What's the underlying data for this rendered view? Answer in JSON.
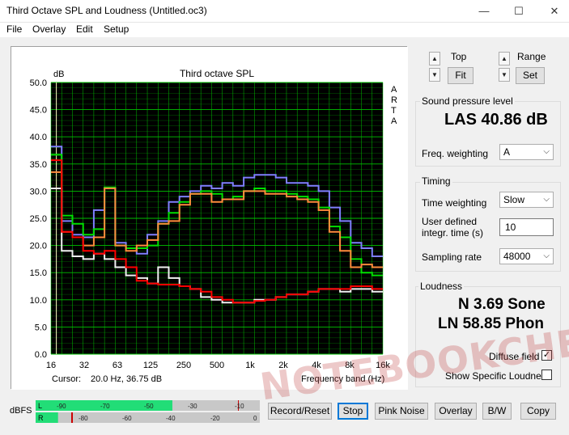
{
  "window": {
    "title": "Third Octave SPL and Loudness (Untitled.oc3)",
    "minimize": "—",
    "maximize": "☐",
    "close": "✕"
  },
  "menu": [
    "File",
    "Overlay",
    "Edit",
    "Setup"
  ],
  "plot": {
    "cursor_label": "Cursor:",
    "cursor_value": "20.0 Hz, 36.75 dB",
    "arta_letters": [
      "A",
      "R",
      "T",
      "A"
    ]
  },
  "chart_data": {
    "type": "line",
    "title": "Third octave SPL",
    "ylabel": "dB",
    "xlabel": "Frequency band (Hz)",
    "ylim": [
      0,
      50
    ],
    "yticks": [
      "50.0",
      "45.0",
      "40.0",
      "35.0",
      "30.0",
      "25.0",
      "20.0",
      "15.0",
      "10.0",
      "5.0",
      "0.0"
    ],
    "xtick_labels": [
      "16",
      "32",
      "63",
      "125",
      "250",
      "500",
      "1k",
      "2k",
      "4k",
      "8k",
      "16k"
    ],
    "bands": [
      "20",
      "25",
      "31.5",
      "40",
      "50",
      "63",
      "80",
      "100",
      "125",
      "160",
      "200",
      "250",
      "315",
      "400",
      "500",
      "630",
      "800",
      "1k",
      "1.25k",
      "1.6k",
      "2k",
      "2.5k",
      "3.15k",
      "4k",
      "5k",
      "6.3k",
      "8k",
      "10k",
      "12.5k",
      "16k",
      "20k"
    ],
    "grid": true,
    "background": "#000000",
    "grid_color": "#00c000",
    "series": [
      {
        "color": "#7f7fff",
        "values": [
          38.2,
          24.5,
          22.0,
          21.5,
          26.5,
          30.5,
          20.5,
          19.5,
          18.5,
          22.0,
          24.5,
          28.0,
          29.0,
          30.0,
          31.0,
          30.5,
          31.5,
          31.0,
          32.5,
          33.0,
          33.0,
          32.5,
          31.5,
          31.5,
          31.0,
          30.0,
          27.0,
          24.5,
          20.5,
          19.5,
          18.0
        ]
      },
      {
        "color": "#00e000",
        "values": [
          36.7,
          25.5,
          24.0,
          22.0,
          23.0,
          30.7,
          20.0,
          19.5,
          19.5,
          20.0,
          24.0,
          26.0,
          28.0,
          29.5,
          30.0,
          29.5,
          28.5,
          29.0,
          30.0,
          30.5,
          30.0,
          30.0,
          29.5,
          29.0,
          28.5,
          27.0,
          23.5,
          21.5,
          17.5,
          15.0,
          14.5
        ]
      },
      {
        "color": "#ff8c3c",
        "values": [
          33.5,
          22.5,
          21.5,
          20.0,
          21.5,
          30.5,
          20.0,
          19.0,
          20.0,
          21.0,
          24.0,
          24.5,
          27.5,
          29.5,
          29.5,
          28.0,
          28.5,
          28.5,
          30.0,
          30.0,
          29.5,
          29.5,
          29.0,
          28.5,
          28.0,
          26.5,
          22.5,
          19.0,
          16.0,
          16.5,
          16.0
        ]
      },
      {
        "color": "#f0f0f0",
        "values": [
          30.5,
          19.0,
          18.0,
          17.5,
          18.5,
          17.5,
          16.0,
          14.5,
          14.0,
          13.0,
          16.0,
          14.0,
          12.5,
          12.0,
          10.5,
          10.0,
          9.5,
          9.5,
          9.5,
          10.0,
          10.0,
          10.5,
          11.0,
          11.0,
          11.5,
          12.0,
          12.0,
          11.5,
          12.0,
          12.0,
          11.5
        ]
      },
      {
        "color": "#ff0000",
        "values": [
          35.7,
          22.5,
          21.5,
          19.0,
          18.5,
          19.0,
          17.5,
          16.0,
          13.5,
          13.0,
          12.8,
          12.8,
          12.5,
          12.0,
          11.5,
          10.5,
          10.0,
          9.5,
          9.5,
          9.8,
          10.0,
          10.5,
          11.0,
          11.0,
          11.5,
          12.0,
          12.0,
          12.0,
          12.5,
          12.5,
          12.0
        ]
      }
    ]
  },
  "top": {
    "label": "Top",
    "button": "Fit"
  },
  "range": {
    "label": "Range",
    "button": "Set"
  },
  "spl": {
    "group_title": "Sound pressure level",
    "value": "LAS 40.86 dB",
    "freq_weighting_label": "Freq. weighting",
    "freq_weighting_value": "A"
  },
  "timing": {
    "group_title": "Timing",
    "time_weighting_label": "Time weighting",
    "time_weighting_value": "Slow",
    "integr_label_1": "User defined",
    "integr_label_2": "integr. time (s)",
    "integr_value": "10",
    "sampling_label": "Sampling rate",
    "sampling_value": "48000"
  },
  "loudness": {
    "group_title": "Loudness",
    "sone": "N 3.69 Sone",
    "phon": "LN 58.85 Phon",
    "diffuse_label": "Diffuse field",
    "diffuse_checked": true,
    "specific_label": "Show Specific Loudness",
    "specific_checked": false
  },
  "meter": {
    "label": "dBFS",
    "channels": [
      "L",
      "R"
    ],
    "ticks_top": [
      "-90",
      "-70",
      "-50",
      "-30",
      "-10"
    ],
    "ticks_bottom": [
      "-80",
      "-60",
      "-40",
      "-20",
      "0"
    ],
    "left_fill": 0.61,
    "right_fill": 0.1
  },
  "bottom_buttons": [
    "Record/Reset",
    "Stop",
    "Pink Noise",
    "Overlay",
    "B/W",
    "Copy"
  ],
  "watermark": "NOTEBOOKCHECK"
}
